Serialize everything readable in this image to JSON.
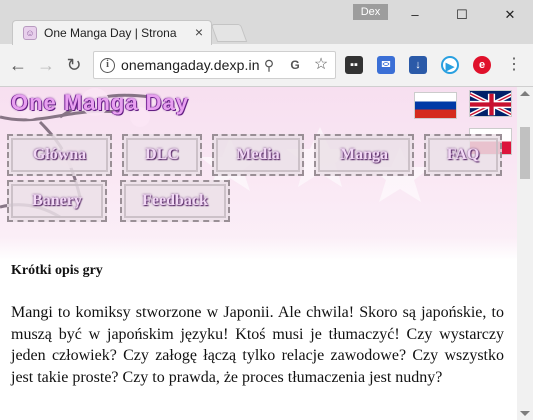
{
  "browser": {
    "tab_title": "One Manga Day | Strona",
    "profile_name": "Dex",
    "url": "onemangaday.dexp.in",
    "icons": {
      "back": "arrow-left-icon",
      "forward": "arrow-right-icon",
      "reload": "reload-icon",
      "info": "info-icon",
      "zoom": "magnifier-icon",
      "translate": "translate-icon",
      "bookmark": "star-icon",
      "menu": "kebab-menu-icon"
    },
    "window_controls": {
      "minimize": "–",
      "maximize": "☐",
      "close": "✕"
    }
  },
  "site": {
    "logo": "One Manga Day",
    "languages": [
      "Russian",
      "English",
      "Polish"
    ],
    "nav": {
      "row1": [
        "Główna",
        "DLC",
        "Media",
        "Manga",
        "FAQ"
      ],
      "row2": [
        "Banery",
        "Feedback"
      ]
    },
    "section_title": "Krótki opis gry",
    "description": "Mangi to komiksy stworzone w Japonii. Ale chwila! Skoro są japońskie, to muszą być w japońskim języku! Ktoś musi je tłumaczyć! Czy wystarczy jeden człowiek? Czy załogę łączą tylko relacje zawodowe? Czy wszystko jest takie proste? Czy to prawda, że proces tłumaczenia jest nudny?"
  },
  "colors": {
    "logo": "#e8a0f0",
    "page_background": "#f7dff0",
    "menu_text": "#f2d8f5"
  }
}
